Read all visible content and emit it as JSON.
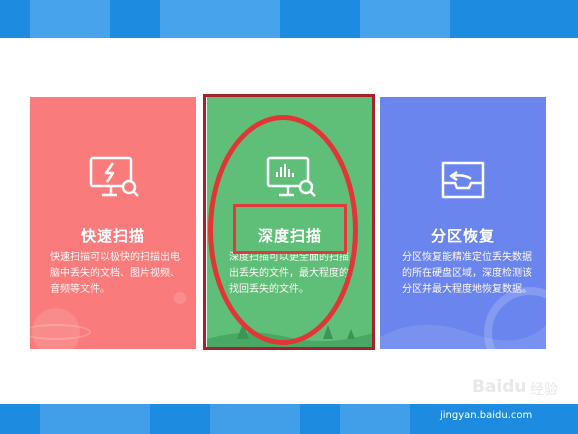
{
  "cards": [
    {
      "title": "快速扫描",
      "description": "快速扫描可以极快的扫描出电脑中丢失的文档、图片视频、音频等文件。",
      "icon": "monitor-lightning-search-icon",
      "color": "#f97b7b"
    },
    {
      "title": "深度扫描",
      "description": "深度扫描可以更全面的扫描出丢失的文件，最大程度的找回丢失的文件。",
      "icon": "monitor-chart-search-icon",
      "color": "#5fbf78"
    },
    {
      "title": "分区恢复",
      "description": "分区恢复能精准定位丢失数据的所在硬盘区域，深度检测该分区并最大程度地恢复数据。",
      "icon": "tray-restore-icon",
      "color": "#6a86ee"
    }
  ],
  "annotation_color": "#e23636",
  "watermark": {
    "logo": "Baidu",
    "cn": "经验",
    "url": "jingyan.baidu.com"
  }
}
